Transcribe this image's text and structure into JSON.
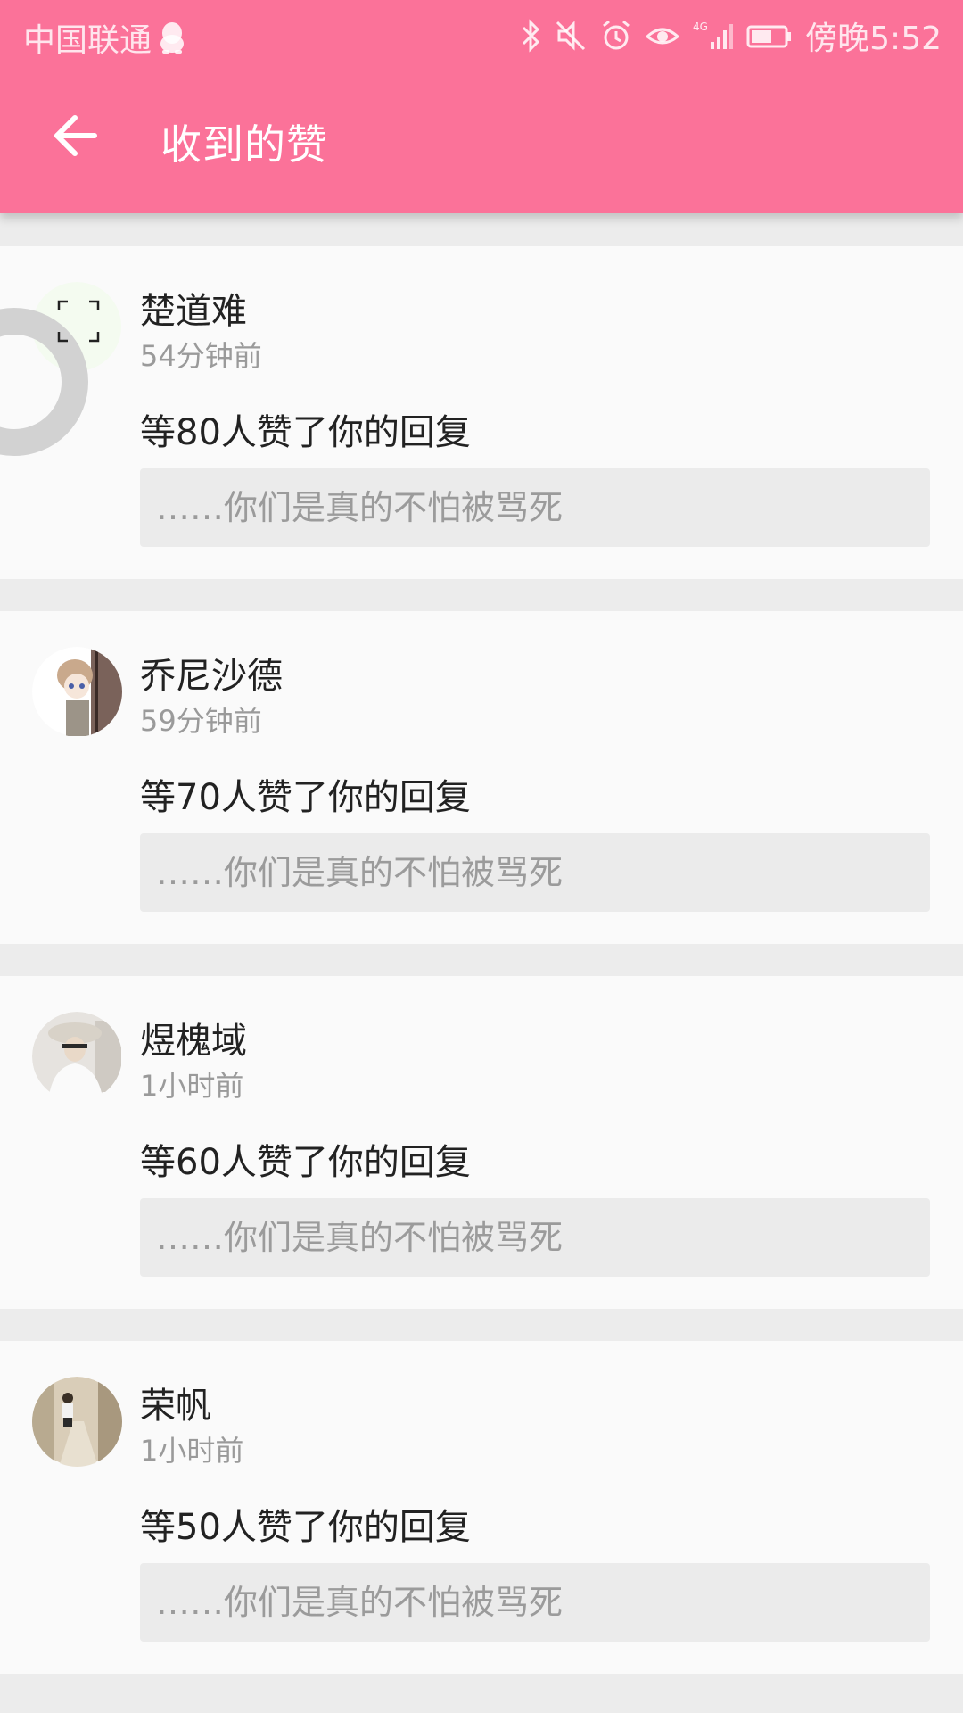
{
  "status_bar": {
    "carrier": "中国联通",
    "clock": "傍晚5:52",
    "network": "4G",
    "icons": [
      "qq-penguin-icon",
      "bluetooth-icon",
      "mute-icon",
      "alarm-icon",
      "eye-comfort-icon",
      "signal-icon",
      "battery-icon"
    ]
  },
  "header": {
    "title": "收到的赞",
    "back_icon": "arrow-left-icon",
    "background": "#fb7299"
  },
  "notifications": [
    {
      "name": "楚道难",
      "time": "54分钟前",
      "text": "等80人赞了你的回复",
      "quote": "……你们是真的不怕被骂死"
    },
    {
      "name": "乔尼沙德",
      "time": "59分钟前",
      "text": "等70人赞了你的回复",
      "quote": "……你们是真的不怕被骂死"
    },
    {
      "name": "煜槐域",
      "time": "1小时前",
      "text": "等60人赞了你的回复",
      "quote": "……你们是真的不怕被骂死"
    },
    {
      "name": "荣帆",
      "time": "1小时前",
      "text": "等50人赞了你的回复",
      "quote": "……你们是真的不怕被骂死"
    }
  ]
}
